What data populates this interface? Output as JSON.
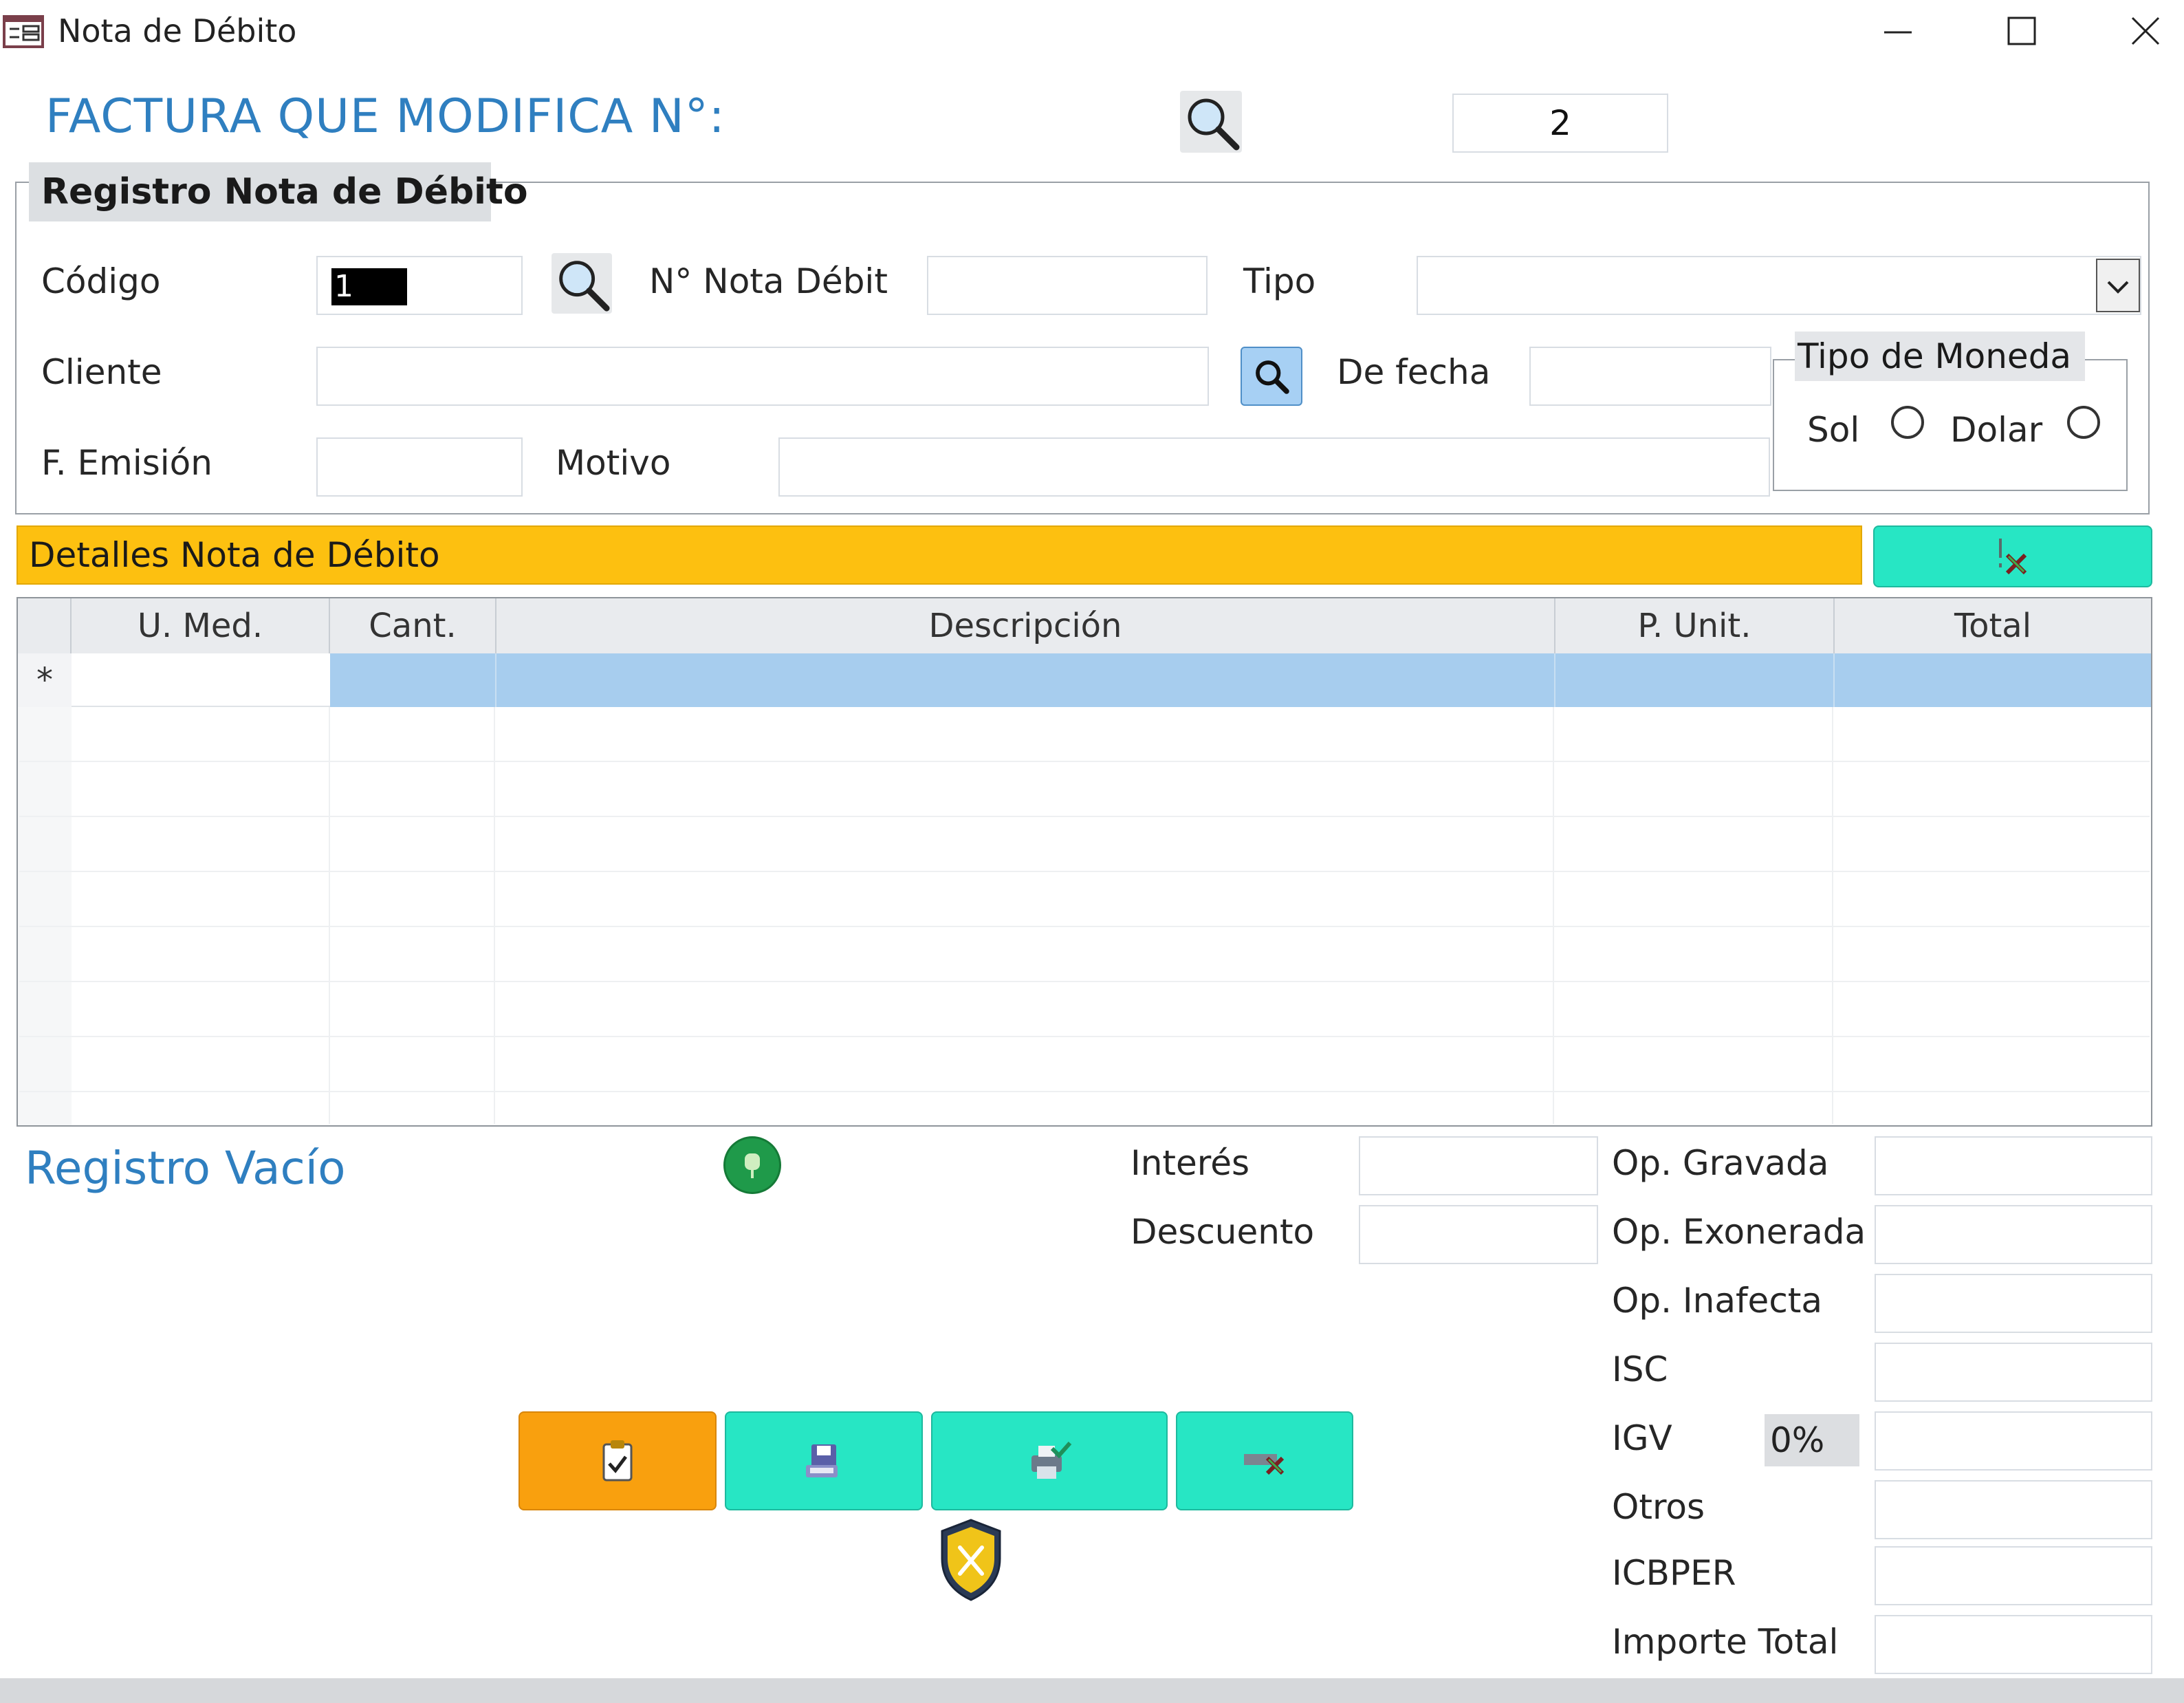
{
  "window": {
    "title": "Nota de Débito"
  },
  "header": {
    "title": "FACTURA  QUE MODIFICA N°:",
    "invoice_number": "2"
  },
  "registro": {
    "title": "Registro Nota de Débito",
    "codigo_label": "Código",
    "codigo_value": "1",
    "nota_label": "N° Nota Débit",
    "tipo_label": "Tipo",
    "cliente_label": "Cliente",
    "defecha_label": "De fecha",
    "femision_label": "F. Emisión",
    "motivo_label": "Motivo",
    "moneda": {
      "title": "Tipo de Moneda",
      "sol_label": "Sol",
      "dolar_label": "Dolar"
    }
  },
  "detalles": {
    "title": "Detalles Nota de Débito",
    "columns": [
      "U. Med.",
      "Cant.",
      "Descripción",
      "P. Unit.",
      "Total"
    ],
    "new_row_marker": "*"
  },
  "status": {
    "text": "Registro Vacío"
  },
  "totals": {
    "interes_label": "Interés",
    "descuento_label": "Descuento",
    "op_gravada_label": "Op. Gravada",
    "op_exonerada_label": "Op. Exonerada",
    "op_inafecta_label": "Op. Inafecta",
    "isc_label": "ISC",
    "igv_label": "IGV",
    "igv_percent": "0%",
    "otros_label": "Otros",
    "icbper_label": "ICBPER",
    "importe_total_label": "Importe Total"
  },
  "colors": {
    "title_blue": "#2f7fc0",
    "detalles_bar": "#fdc010",
    "teal_button": "#27e6c4",
    "orange_button": "#f9a00e",
    "row_selected": "#a7cdee"
  },
  "icons": [
    "search-icon",
    "dropdown-chevron-icon",
    "remove-row-icon",
    "pin-icon",
    "clipboard-check-icon",
    "save-disk-icon",
    "print-icon",
    "cancel-icon",
    "shield-icon"
  ]
}
